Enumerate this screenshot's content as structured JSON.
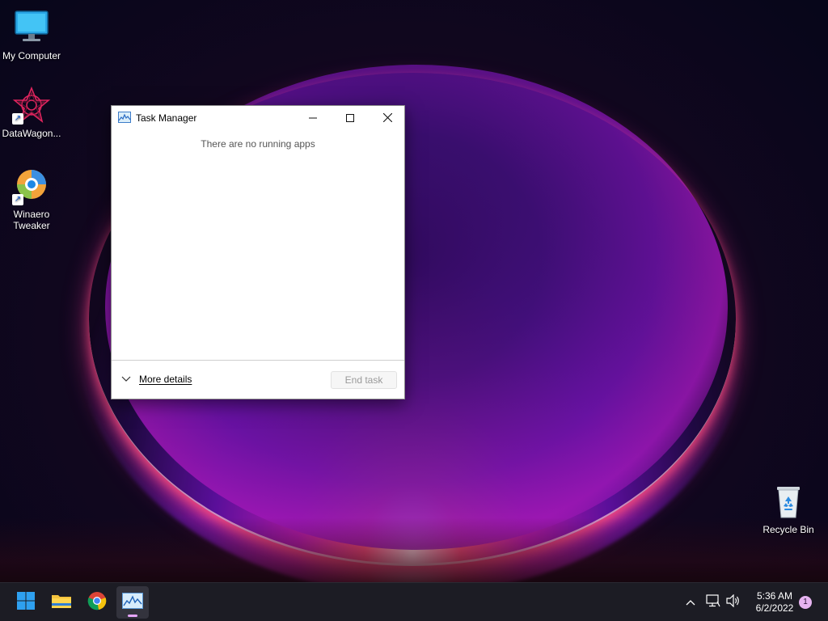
{
  "desktop": {
    "icons": [
      {
        "label": "My Computer"
      },
      {
        "label": "DataWagon..."
      },
      {
        "label_line1": "Winaero",
        "label_line2": "Tweaker"
      },
      {
        "label": "Recycle Bin"
      }
    ]
  },
  "window": {
    "title": "Task Manager",
    "empty_message": "There are no running apps",
    "more_details_label": "More details",
    "end_task_label": "End task"
  },
  "taskbar": {
    "clock_time": "5:36 AM",
    "clock_date": "6/2/2022",
    "notification_count": "1"
  },
  "colors": {
    "taskbar_bg": "#1c1c24",
    "active_indicator": "#e7a6ff",
    "window_bg": "#ffffff"
  }
}
